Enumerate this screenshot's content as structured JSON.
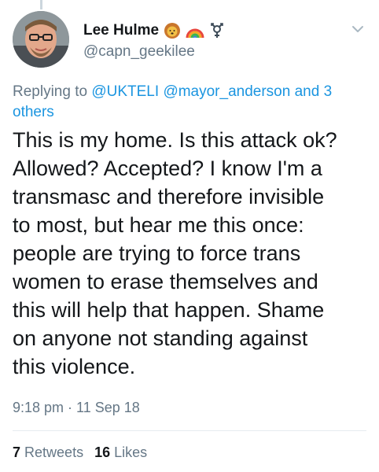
{
  "author": {
    "display_name": "Lee Hulme",
    "handle": "@capn_geekilee",
    "emojis": [
      "lion-face-icon",
      "rainbow-icon",
      "transgender-symbol-icon"
    ]
  },
  "reply": {
    "prefix": "Replying to",
    "mentions": [
      "@UKTELI",
      "@mayor_anderson"
    ],
    "joiner": "and 3",
    "others": "others"
  },
  "tweet": {
    "lines": [
      "This is my home. Is this attack ok?",
      "Allowed? Accepted? I know I'm a",
      "transmasc and therefore invisible",
      "to most, but hear me this once:",
      "people are trying to force trans",
      "women to erase themselves and",
      "this will help that happen. Shame",
      "on anyone not standing against",
      "this violence."
    ],
    "timestamp": "9:18 pm · 11 Sep 18"
  },
  "stats": {
    "retweets_count": "7",
    "retweets_label": "Retweets",
    "likes_count": "16",
    "likes_label": "Likes"
  },
  "colors": {
    "link": "#1b95e0",
    "muted": "#657786",
    "text": "#14171a"
  }
}
